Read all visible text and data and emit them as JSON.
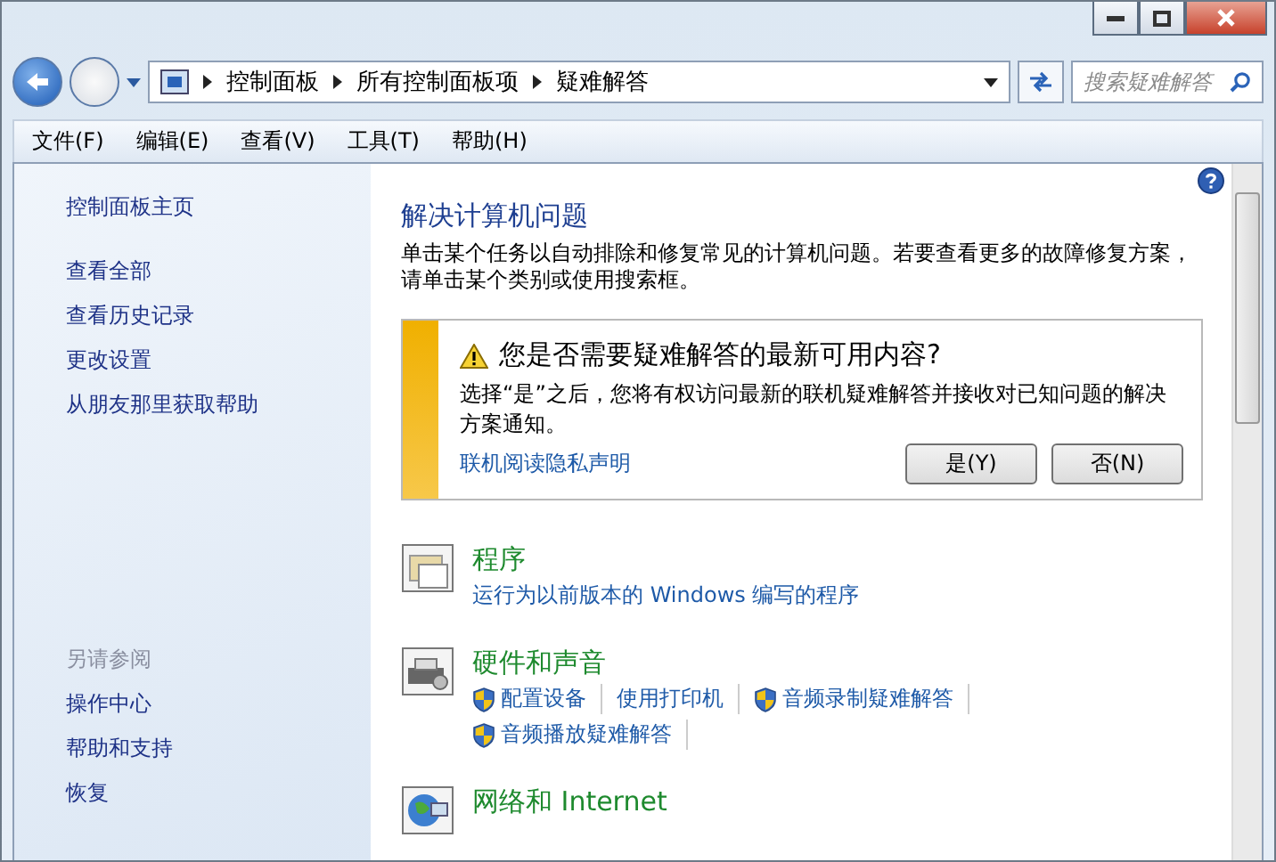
{
  "address_bar": {
    "breadcrumbs": [
      "控制面板",
      "所有控制面板项",
      "疑难解答"
    ]
  },
  "search": {
    "placeholder": "搜索疑难解答"
  },
  "menu": [
    "文件(F)",
    "编辑(E)",
    "查看(V)",
    "工具(T)",
    "帮助(H)"
  ],
  "sidebar": {
    "home": "控制面板主页",
    "items": [
      "查看全部",
      "查看历史记录",
      "更改设置",
      "从朋友那里获取帮助"
    ],
    "see_also": {
      "title": "另请参阅",
      "items": [
        "操作中心",
        "帮助和支持",
        "恢复"
      ]
    }
  },
  "main": {
    "title": "解决计算机问题",
    "description": "单击某个任务以自动排除和修复常见的计算机问题。若要查看更多的故障修复方案，请单击某个类别或使用搜索框。",
    "notice": {
      "title": "您是否需要疑难解答的最新可用内容?",
      "text": "选择“是”之后，您将有权访问最新的联机疑难解答并接收对已知问题的解决方案通知。",
      "link": "联机阅读隐私声明",
      "buttons": [
        "是(Y)",
        "否(N)"
      ]
    },
    "categories": [
      {
        "kind": "programs",
        "title": "程序",
        "links": [
          {
            "label": "运行为以前版本的 Windows 编写的程序",
            "shield": false
          }
        ]
      },
      {
        "kind": "hardware",
        "title": "硬件和声音",
        "links": [
          {
            "label": "配置设备",
            "shield": true
          },
          {
            "label": "使用打印机",
            "shield": false
          },
          {
            "label": "音频录制疑难解答",
            "shield": true
          },
          {
            "label": "音频播放疑难解答",
            "shield": true
          }
        ]
      },
      {
        "kind": "network",
        "title": "网络和 Internet"
      }
    ]
  }
}
